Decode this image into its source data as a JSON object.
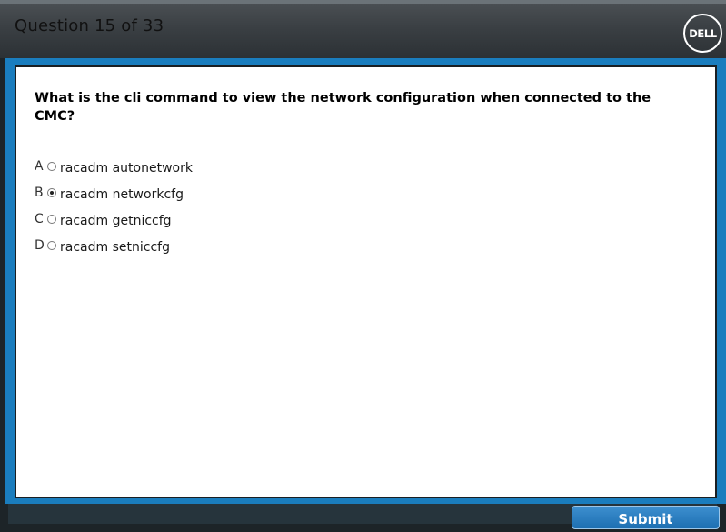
{
  "header": {
    "title": "Question 15 of 33",
    "logo_text": "DELL"
  },
  "question": {
    "text": "What is the cli command to view the network configuration when connected to the CMC?"
  },
  "options": [
    {
      "letter": "A",
      "text": "racadm autonetwork",
      "selected": false
    },
    {
      "letter": "B",
      "text": "racadm networkcfg",
      "selected": true
    },
    {
      "letter": "C",
      "text": "racadm getniccfg",
      "selected": false
    },
    {
      "letter": "D",
      "text": "racadm setniccfg",
      "selected": false
    }
  ],
  "footer": {
    "submit_label": "Submit"
  },
  "colors": {
    "frame_blue": "#1a7dbe",
    "submit_blue": "#2a7cc0"
  }
}
